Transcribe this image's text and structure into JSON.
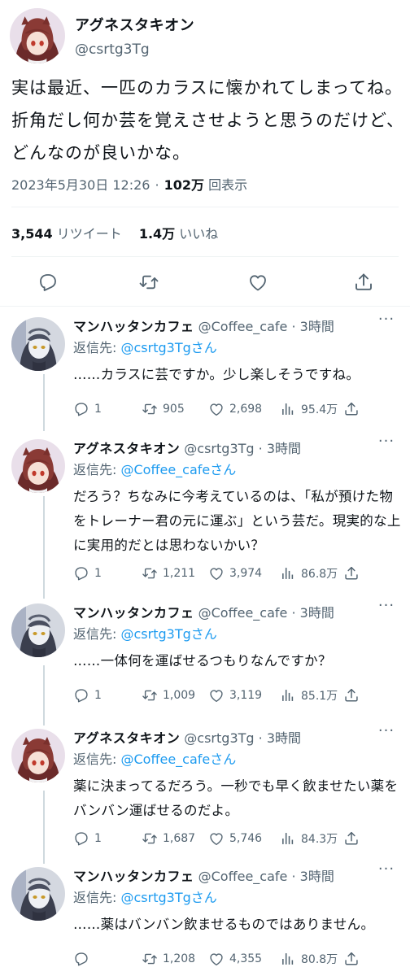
{
  "main_tweet": {
    "author_name": "アグネスタキオン",
    "author_handle": "@csrtg3Tg",
    "text": "実は最近、一匹のカラスに懐かれてしまってね。折角だし何か芸を覚えさせようと思うのだけど、どんなのが良いかな。",
    "date": "2023年5月30日 12:26",
    "views_count": "102万",
    "views_label": "回表示",
    "retweets_count": "3,544",
    "retweets_label": "リツイート",
    "likes_count": "1.4万",
    "likes_label": "いいね",
    "actions": [
      "reply-icon",
      "retweet-icon",
      "like-icon",
      "share-icon"
    ]
  },
  "replies": [
    {
      "author_name": "マンハッタンカフェ",
      "author_handle": "@Coffee_cafe",
      "time": "3時間",
      "reply_to_label": "返信先:",
      "reply_to_mention": "@csrtg3Tgさん",
      "text": "……カラスに芸ですか。少し楽しそうですね。",
      "reply_count": "1",
      "retweet_count": "905",
      "like_count": "2,698",
      "view_count": "95.4万"
    },
    {
      "author_name": "アグネスタキオン",
      "author_handle": "@csrtg3Tg",
      "time": "3時間",
      "reply_to_label": "返信先:",
      "reply_to_mention": "@Coffee_cafeさん",
      "text": "だろう？ちなみに今考えているのは、「私が預けた物をトレーナー君の元に運ぶ」という芸だ。現実的な上に実用的だとは思わないかい？",
      "reply_count": "1",
      "retweet_count": "1,211",
      "like_count": "3,974",
      "view_count": "86.8万"
    },
    {
      "author_name": "マンハッタンカフェ",
      "author_handle": "@Coffee_cafe",
      "time": "3時間",
      "reply_to_label": "返信先:",
      "reply_to_mention": "@csrtg3Tgさん",
      "text": "……一体何を運ばせるつもりなんですか？",
      "reply_count": "1",
      "retweet_count": "1,009",
      "like_count": "3,119",
      "view_count": "85.1万"
    },
    {
      "author_name": "アグネスタキオン",
      "author_handle": "@csrtg3Tg",
      "time": "3時間",
      "reply_to_label": "返信先:",
      "reply_to_mention": "@Coffee_cafeさん",
      "text": "薬に決まってるだろう。一秒でも早く飲ませたい薬をバンバン運ばせるのだよ。",
      "reply_count": "1",
      "retweet_count": "1,687",
      "like_count": "5,746",
      "view_count": "84.3万"
    },
    {
      "author_name": "マンハッタンカフェ",
      "author_handle": "@Coffee_cafe",
      "time": "3時間",
      "reply_to_label": "返信先:",
      "reply_to_mention": "@csrtg3Tgさん",
      "text": "……薬はバンバン飲ませるものではありません。",
      "reply_count": "",
      "retweet_count": "1,208",
      "like_count": "4,355",
      "view_count": "80.8万"
    }
  ],
  "colors": {
    "text": "#0f1419",
    "secondary": "#536471",
    "link": "#1d9bf0",
    "divider": "#eff3f4",
    "thread_line": "#cfd9de"
  },
  "separators": {
    "time_dot": "·"
  }
}
